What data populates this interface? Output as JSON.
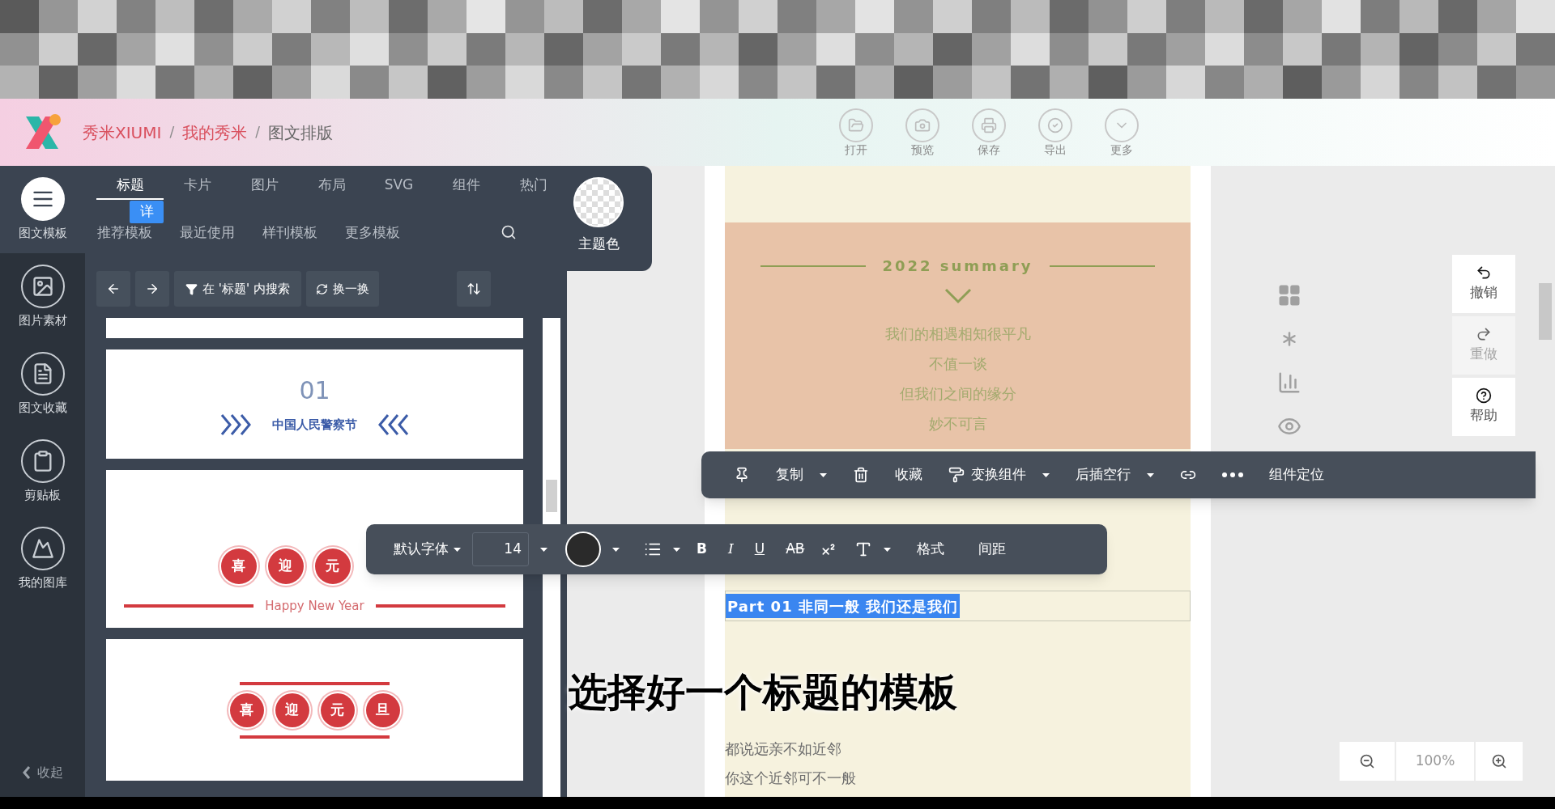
{
  "header": {
    "breadcrumb": [
      "秀米XIUMI",
      "我的秀米",
      "图文排版"
    ],
    "separator": "/",
    "actions": [
      {
        "label": "打开",
        "kind": "open"
      },
      {
        "label": "预览",
        "kind": "preview"
      },
      {
        "label": "保存",
        "kind": "save"
      },
      {
        "label": "导出",
        "kind": "export"
      },
      {
        "label": "更多",
        "kind": "more"
      }
    ]
  },
  "rail": {
    "items": [
      {
        "label": "图文模板",
        "kind": "doc",
        "selected": true
      },
      {
        "label": "图片素材",
        "kind": "image",
        "selected": false
      },
      {
        "label": "图文收藏",
        "kind": "favorite",
        "selected": false
      },
      {
        "label": "剪贴板",
        "kind": "clipboard",
        "selected": false
      },
      {
        "label": "我的图库",
        "kind": "gallery",
        "selected": false
      }
    ],
    "collapse": "收起"
  },
  "panel": {
    "tabs": [
      {
        "label": "标题",
        "selected": true
      },
      {
        "label": "卡片",
        "selected": false
      },
      {
        "label": "图片",
        "selected": false
      },
      {
        "label": "布局",
        "selected": false
      },
      {
        "label": "SVG",
        "selected": false
      },
      {
        "label": "组件",
        "selected": false
      },
      {
        "label": "热门",
        "selected": false
      }
    ],
    "badge": "详",
    "subtabs": [
      "推荐模板",
      "最近使用",
      "样刊模板",
      "更多模板"
    ],
    "theme_color": "主题色",
    "search_in": "在 '标题' 内搜索",
    "shuffle": "换一换",
    "templates": [
      {
        "kind": "partial"
      },
      {
        "kind": "police",
        "number": "01",
        "title": "中国人民警察节"
      },
      {
        "kind": "newyear",
        "chars": [
          "喜",
          "迎",
          "元"
        ],
        "caption": "Happy New Year"
      },
      {
        "kind": "newyear-frame",
        "chars": [
          "喜",
          "迎",
          "元",
          "旦"
        ]
      }
    ]
  },
  "article": {
    "heading": "2022 summary",
    "lines": [
      "我们的相遇相知很平凡",
      "不值一谈",
      "但我们之间的缘分",
      "妙不可言"
    ],
    "selected_line": "Part 01 非同一般 我们还是我们",
    "body": [
      "都说远亲不如近邻",
      "你这个近邻可不一般"
    ]
  },
  "component_toolbar": [
    {
      "kind": "pin"
    },
    {
      "kind": "menu",
      "label": "复制"
    },
    {
      "kind": "trash"
    },
    {
      "kind": "text",
      "label": "收藏"
    },
    {
      "kind": "roller-menu",
      "label": "变换组件"
    },
    {
      "kind": "menu",
      "label": "后插空行"
    },
    {
      "kind": "link"
    },
    {
      "kind": "more"
    },
    {
      "kind": "text",
      "label": "组件定位"
    }
  ],
  "text_toolbar": {
    "font": "默认字体",
    "size": "14",
    "styles": [
      "B",
      "I",
      "U",
      "AB"
    ],
    "format": "格式",
    "spacing": "间距"
  },
  "side_buttons": [
    {
      "label": "撤销",
      "kind": "undo",
      "disabled": false
    },
    {
      "label": "重做",
      "kind": "redo",
      "disabled": true
    },
    {
      "label": "帮助",
      "kind": "help",
      "disabled": false
    }
  ],
  "zoom": "100%",
  "subtitle": "选择好一个标题的模板"
}
